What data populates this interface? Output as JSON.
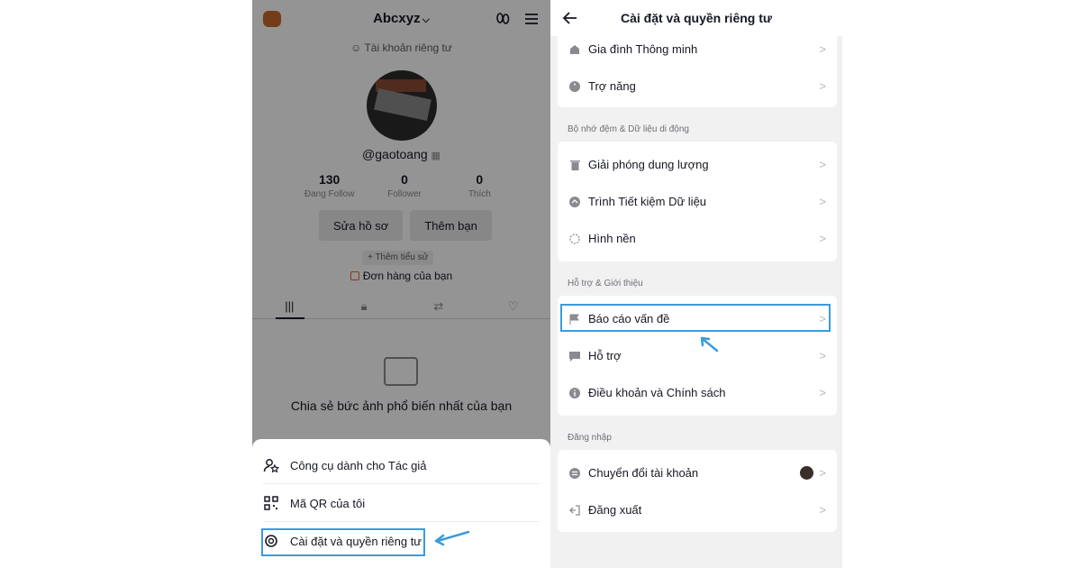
{
  "left": {
    "account_name": "Abcxyz",
    "private_label": "Tài khoản riêng tư",
    "username": "@gaotoang",
    "stats": [
      {
        "value": "130",
        "label": "Đang Follow"
      },
      {
        "value": "0",
        "label": "Follower"
      },
      {
        "value": "0",
        "label": "Thích"
      }
    ],
    "edit_profile": "Sửa hồ sơ",
    "add_friend": "Thêm bạn",
    "add_bio": "+ Thêm tiểu sử",
    "orders": "Đơn hàng của bạn",
    "empty_text": "Chia sẻ bức ảnh phổ biến nhất của bạn",
    "sheet": {
      "creator_tools": "Công cụ dành cho Tác giả",
      "qr_code": "Mã QR của tôi",
      "settings": "Cài đặt và quyền riêng tư"
    }
  },
  "right": {
    "title": "Cài đặt và quyền riêng tư",
    "top_items": [
      "Gia đình Thông minh",
      "Trợ năng"
    ],
    "sections": [
      {
        "label": "Bộ nhớ đệm & Dữ liệu di động",
        "items": [
          "Giải phóng dung lượng",
          "Trình Tiết kiệm Dữ liệu",
          "Hình nền"
        ]
      },
      {
        "label": "Hỗ trợ & Giới thiệu",
        "items": [
          "Báo cáo vấn đề",
          "Hỗ trợ",
          "Điều khoản và Chính sách"
        ]
      },
      {
        "label": "Đăng nhập",
        "items": [
          "Chuyển đổi tài khoản",
          "Đăng xuất"
        ]
      }
    ]
  },
  "colors": {
    "highlight": "#3a9bdc",
    "accent_orange": "#e06a2e"
  }
}
